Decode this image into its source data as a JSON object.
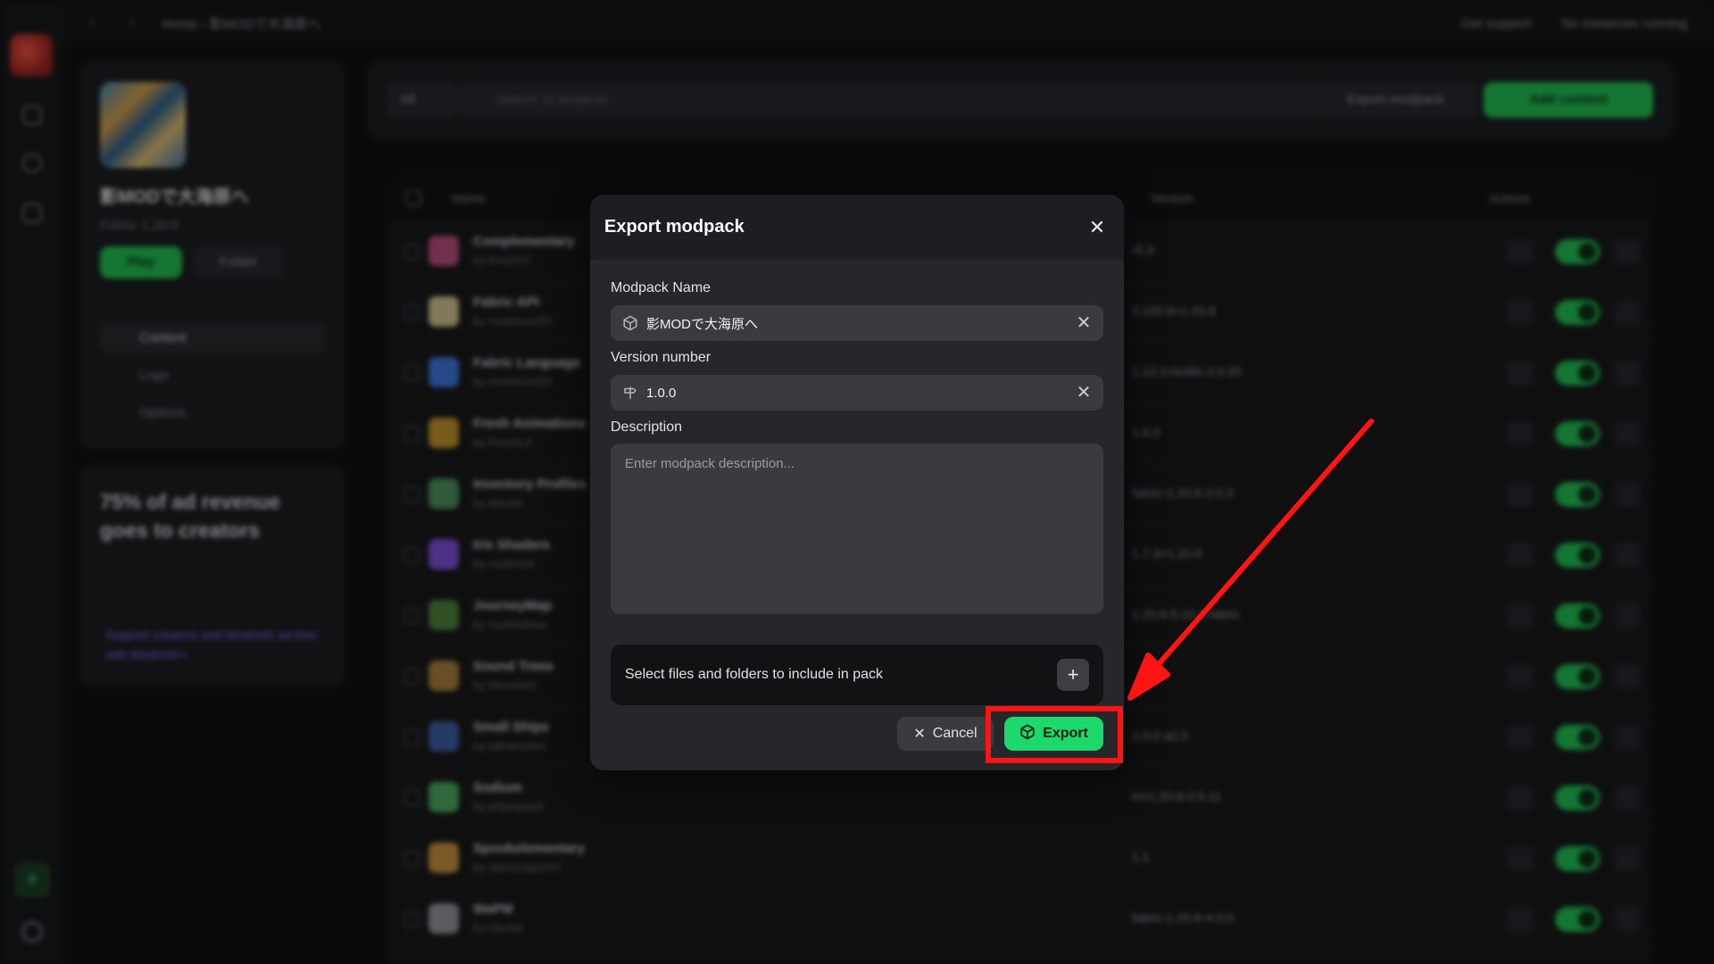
{
  "topbar": {
    "nav": "‹ ›",
    "breadcrumb": "Home › 影MODで大海原へ",
    "support": "Get support",
    "instances": "No instances running"
  },
  "sidebar": {
    "project_name": "影MODで大海原へ",
    "loader_version": "Fabric 1.20.6",
    "play_label": "Play",
    "folder_label": "Folder",
    "menu": [
      {
        "label": "Content"
      },
      {
        "label": "Logs"
      },
      {
        "label": "Options"
      }
    ]
  },
  "ad": {
    "headline": "75% of ad revenue goes to creators",
    "footer": "Support creators and Modrinth ad-free with Modrinth+"
  },
  "toolbar": {
    "filter_label": "All",
    "search_placeholder": "Search 12 projects...",
    "export_label": "Export modpack",
    "add_label": "Add content"
  },
  "table": {
    "columns": [
      "Name",
      "Version",
      "Actions"
    ],
    "rows": [
      {
        "name": "Complementary",
        "author": "by EminGT",
        "version": "r5.3",
        "color": "#b04a7a"
      },
      {
        "name": "Fabric API",
        "author": "by modmuss50",
        "version": "0.100.8+1.20.6",
        "color": "#c9b98a"
      },
      {
        "name": "Fabric Language",
        "author": "by modmuss50",
        "version": "1.12.2+kotlin.2.0.20",
        "color": "#3a6fd0"
      },
      {
        "name": "Fresh Animations",
        "author": "by FreshLX",
        "version": "1.9.3",
        "color": "#b88a2a"
      },
      {
        "name": "Inventory Profiles",
        "author": "by blackd",
        "version": "fabric-1.20.6-2.0.3",
        "color": "#4a8a5a"
      },
      {
        "name": "Iris Shaders",
        "author": "by coderbot",
        "version": "1.7.3+1.20.6",
        "color": "#7a4ad0"
      },
      {
        "name": "JourneyMap",
        "author": "by mysticdrew",
        "version": "1.20.6-5.10.3-fabric",
        "color": "#4a7a3a"
      },
      {
        "name": "Sound Trees",
        "author": "by Mooshen",
        "version": "",
        "color": "#a07a3a"
      },
      {
        "name": "Small Ships",
        "author": "by talhanation",
        "version": "2.0.0-a2.5",
        "color": "#3a5a9a"
      },
      {
        "name": "Sodium",
        "author": "by jellysquid3",
        "version": "mc1.20.6-0.5.11",
        "color": "#4aa05a"
      },
      {
        "name": "Spookelementary",
        "author": "by SpeeZagee07",
        "version": "1.1",
        "color": "#c08a3a"
      },
      {
        "name": "WaPM",
        "author": "by blackd",
        "version": "fabric-1.20.6-4.0.0",
        "color": "#8a8e95"
      }
    ]
  },
  "modal": {
    "title": "Export modpack",
    "name_label": "Modpack Name",
    "name_value": "影MODで大海原へ",
    "version_label": "Version number",
    "version_value": "1.0.0",
    "description_label": "Description",
    "description_placeholder": "Enter modpack description...",
    "files_label": "Select files and folders to include in pack",
    "cancel_label": "Cancel",
    "export_label": "Export"
  },
  "annotation": {
    "highlight_color": "#ff1414"
  }
}
